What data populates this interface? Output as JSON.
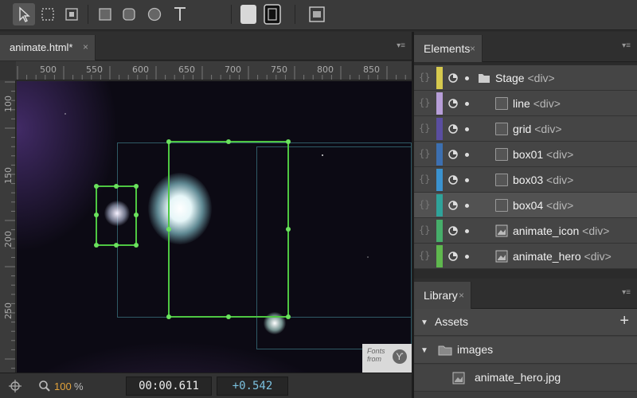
{
  "toolbar": {
    "tools": [
      "select-icon",
      "transform-icon",
      "clip-icon",
      "rectangle-icon",
      "rounded-rectangle-icon",
      "ellipse-icon",
      "text-icon",
      "fill-color-icon",
      "border-color-icon",
      "layout-icon"
    ]
  },
  "document": {
    "tab_label": "animate.html*",
    "close_glyph": "×",
    "menu_glyph": "▾≡"
  },
  "rulers": {
    "horizontal_ticks": [
      "500",
      "550",
      "600",
      "650",
      "700",
      "750",
      "800",
      "850"
    ],
    "vertical_ticks": [
      "100",
      "150",
      "200",
      "250"
    ]
  },
  "stage": {
    "badge_text_line1": "Fonts",
    "badge_text_line2": "from",
    "badge_glyph": "Ƴ"
  },
  "statusbar": {
    "zoom_value": "100",
    "zoom_unit": "%",
    "time": "00:00.611",
    "delta": "+0.542"
  },
  "elements_panel": {
    "title": "Elements",
    "close_glyph": "×",
    "menu_glyph": "▾≡",
    "rows": [
      {
        "name": "Stage",
        "tag": "<div>",
        "color": "#d6c94e",
        "icon": "folder-icon",
        "selected": false
      },
      {
        "name": "line",
        "tag": "<div>",
        "color": "#b79ed8",
        "icon": "box-icon",
        "selected": false
      },
      {
        "name": "grid",
        "tag": "<div>",
        "color": "#5a4ea0",
        "icon": "box-icon",
        "selected": false
      },
      {
        "name": "box01",
        "tag": "<div>",
        "color": "#3c6fb0",
        "icon": "box-icon",
        "selected": false
      },
      {
        "name": "box03",
        "tag": "<div>",
        "color": "#3a92cf",
        "icon": "box-icon",
        "selected": false
      },
      {
        "name": "box04",
        "tag": "<div>",
        "color": "#2fa39a",
        "icon": "box-icon",
        "selected": true
      },
      {
        "name": "animate_icon",
        "tag": "<div>",
        "color": "#46ae6a",
        "icon": "image-icon",
        "selected": false
      },
      {
        "name": "animate_hero",
        "tag": "<div>",
        "color": "#5fb84e",
        "icon": "image-icon",
        "selected": false
      }
    ]
  },
  "library_panel": {
    "title": "Library",
    "close_glyph": "×",
    "menu_glyph": "▾≡",
    "assets_label": "Assets",
    "add_glyph": "+",
    "images_label": "images",
    "file_label": "animate_hero.jpg"
  }
}
